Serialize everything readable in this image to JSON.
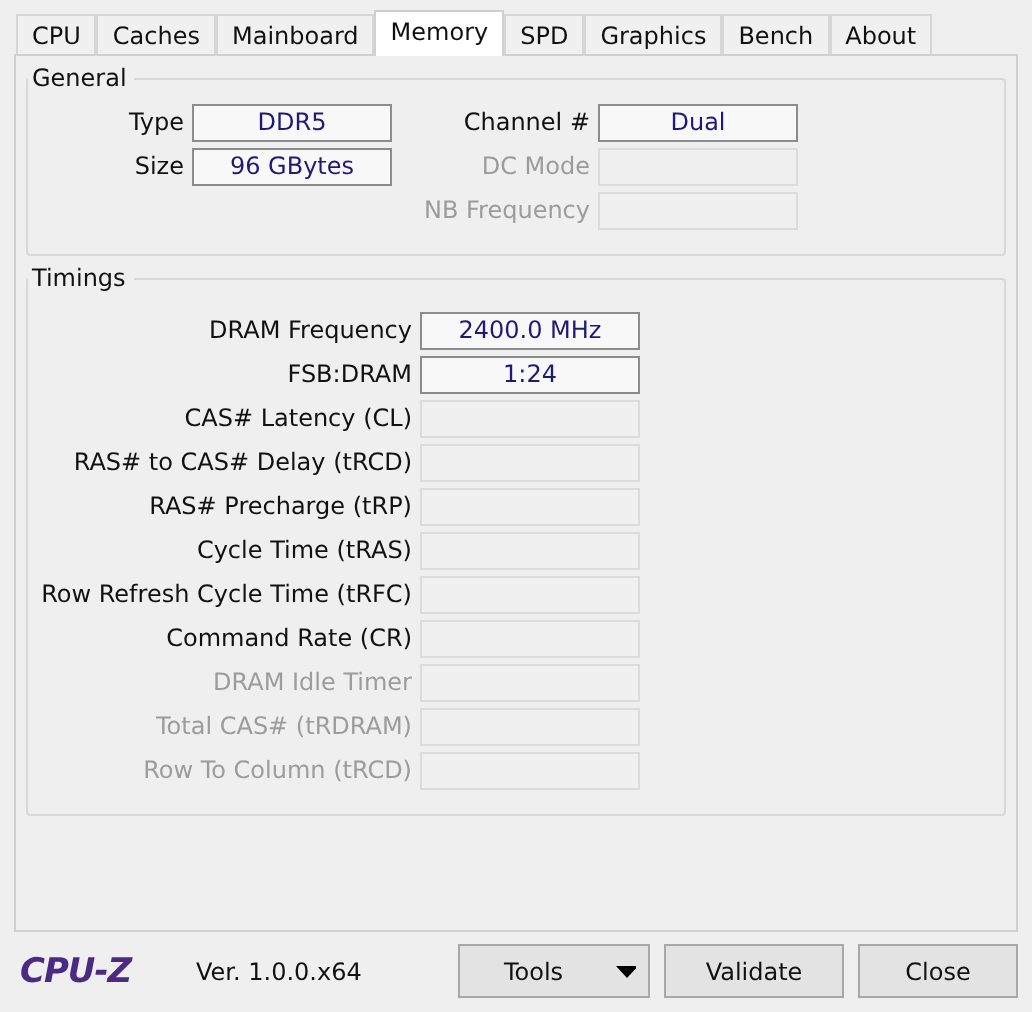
{
  "tabs": [
    {
      "label": "CPU",
      "selected": false
    },
    {
      "label": "Caches",
      "selected": false
    },
    {
      "label": "Mainboard",
      "selected": false
    },
    {
      "label": "Memory",
      "selected": true
    },
    {
      "label": "SPD",
      "selected": false
    },
    {
      "label": "Graphics",
      "selected": false
    },
    {
      "label": "Bench",
      "selected": false
    },
    {
      "label": "About",
      "selected": false
    }
  ],
  "general": {
    "title": "General",
    "columns": [
      [
        {
          "label": "Type",
          "value": "DDR5",
          "disabled": false
        },
        {
          "label": "Size",
          "value": "96 GBytes",
          "disabled": false
        }
      ],
      [
        {
          "label": "Channel #",
          "value": "Dual",
          "disabled": false
        },
        {
          "label": "DC Mode",
          "disabled": true
        },
        {
          "label": "NB Frequency",
          "disabled": true
        }
      ]
    ]
  },
  "timings": {
    "title": "Timings",
    "fields": [
      {
        "label": "DRAM Frequency",
        "value": "2400.0 MHz",
        "disabled": false
      },
      {
        "label": "FSB:DRAM",
        "value": "1:24",
        "disabled": false
      },
      {
        "label": "CAS# Latency (CL)",
        "disabled": false
      },
      {
        "label": "RAS# to CAS# Delay (tRCD)",
        "disabled": false
      },
      {
        "label": "RAS# Precharge (tRP)",
        "disabled": false
      },
      {
        "label": "Cycle Time (tRAS)",
        "disabled": false
      },
      {
        "label": "Row Refresh Cycle Time (tRFC)",
        "disabled": false
      },
      {
        "label": "Command Rate (CR)",
        "disabled": false
      },
      {
        "label": "DRAM Idle Timer",
        "disabled": true
      },
      {
        "label": "Total CAS# (tRDRAM)",
        "disabled": true
      },
      {
        "label": "Row To Column (tRCD)",
        "disabled": true
      }
    ]
  },
  "footer": {
    "logo": "CPU-Z",
    "version": "Ver. 1.0.0.x64",
    "buttons": [
      {
        "label": "Tools",
        "kind": "dropdown"
      },
      {
        "label": "Validate",
        "kind": "plain"
      },
      {
        "label": "Close",
        "kind": "plain"
      }
    ]
  }
}
